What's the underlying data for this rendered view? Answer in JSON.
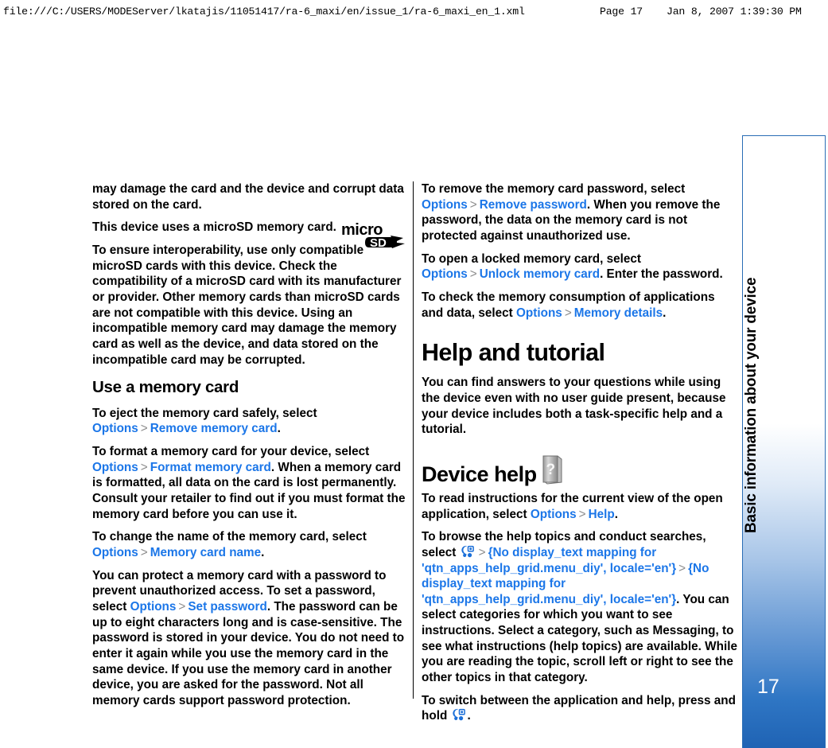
{
  "print_header": {
    "url": "file:///C:/USERS/MODEServer/lkatajis/11051417/ra-6_maxi/en/issue_1/ra-6_maxi_en_1.xml",
    "page": "Page 17",
    "date": "Jan 8, 2007 1:39:30 PM"
  },
  "side_tab": {
    "title": "Basic information about your device",
    "page_number": "17",
    "accent_color": "#2a6db5",
    "gradient_bottom_color": "#1f63b4"
  },
  "icons": {
    "microsd_logo": "microsd-logo",
    "device_help_book": "book-question-icon",
    "menu_key": "menu-key-icon"
  },
  "link_color": "#1b76e8",
  "arrow_color": "#8d8d8d",
  "left_column": {
    "p1": "may damage the card and the device and corrupt data stored on the card.",
    "p2": "This device uses a microSD memory card.",
    "p3": "To ensure interoperability, use only compatible microSD cards with this device. Check the compatibility of a microSD card with its manufacturer or provider. Other memory cards than microSD cards are not compatible with this device. Using an incompatible memory card may damage the memory card as well as the device, and data stored on the incompatible card may be corrupted.",
    "heading_use_memory_card": "Use a memory card",
    "p4_a": "To eject the memory card safely, select ",
    "p4_link1": "Options",
    "p4_arrow": ">",
    "p4_link2": "Remove memory card",
    "p4_b": ".",
    "p5_a": "To format a memory card for your device, select ",
    "p5_link1": "Options",
    "p5_arrow": ">",
    "p5_link2": "Format memory card",
    "p5_b": ". When a memory card is formatted, all data on the card is lost permanently. Consult your retailer to find out if you must format the memory card before you can use it.",
    "p6_a": "To change the name of the memory card, select ",
    "p6_link1": "Options",
    "p6_arrow": ">",
    "p6_link2": "Memory card name",
    "p6_b": ".",
    "p7_a": "You can protect a memory card with a password to prevent unauthorized access. To set a password, select ",
    "p7_link1": "Options",
    "p7_arrow": ">",
    "p7_link2": "Set password",
    "p7_b": ". The password can be up to eight characters long and is case-sensitive. The password is stored in your device. You do not need to enter it again while you use the memory card in the same device. If you use the memory card in another device, you are asked for the password. Not all memory cards support password protection."
  },
  "right_column": {
    "p1_a": "To remove the memory card password, select ",
    "p1_link1": "Options",
    "p1_arrow": ">",
    "p1_link2": "Remove password",
    "p1_b": ". When you remove the password, the data on the memory card is not protected against unauthorized use.",
    "p2_a": "To open a locked memory card, select ",
    "p2_link1": "Options",
    "p2_arrow": ">",
    "p2_link2": "Unlock memory card",
    "p2_b": ". Enter the password.",
    "p3_a": "To check the memory consumption of applications and data, select ",
    "p3_link1": "Options",
    "p3_arrow": ">",
    "p3_link2": "Memory details",
    "p3_b": ".",
    "heading_help_and_tutorial": "Help and tutorial",
    "p4": "You can find answers to your questions while using the device even with no user guide present, because your device includes both a task-specific help and a tutorial.",
    "heading_device_help": "Device help",
    "p5_a": "To read instructions for the current view of the open application, select ",
    "p5_link1": "Options",
    "p5_arrow": ">",
    "p5_link2": "Help",
    "p5_b": ".",
    "p6_a": "To browse the help topics and conduct searches, select ",
    "p6_arrow1": ">",
    "p6_link1": "{No display_text mapping for 'qtn_apps_help_grid.menu_diy', locale='en'}",
    "p6_arrow2": ">",
    "p6_link2": "{No display_text mapping for 'qtn_apps_help_grid.menu_diy', locale='en'}",
    "p6_b": ". You can select categories for which you want to see instructions. Select a category, such as Messaging, to see what instructions (help topics) are available. While you are reading the topic, scroll left or right to see the other topics in that category.",
    "p7_a": "To switch between the application and help, press and hold ",
    "p7_b": "."
  }
}
